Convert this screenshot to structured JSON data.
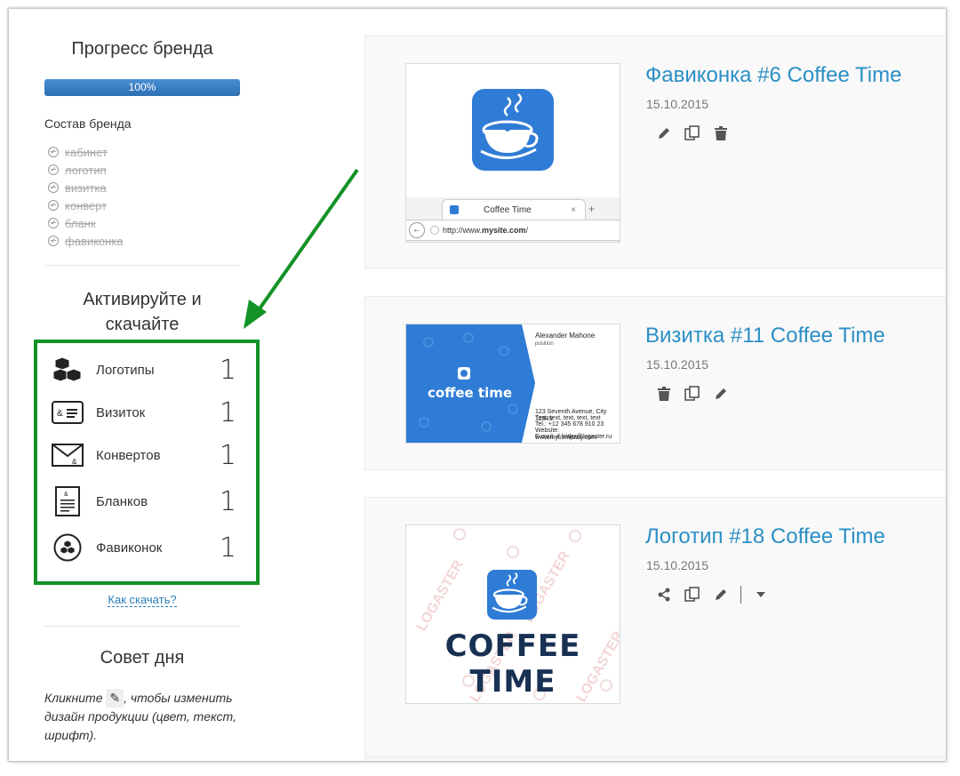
{
  "sidebar": {
    "progress_title": "Прогресс бренда",
    "progress_value": "100%",
    "progress_fraction": 1.0,
    "composition_label": "Состав бренда",
    "composition_items": [
      "кабинет",
      "логотип",
      "визитка",
      "конверт",
      "бланк",
      "фавиконка"
    ],
    "activate_title_line1": "Активируйте и",
    "activate_title_line2": "скачайте",
    "products": [
      {
        "label": "Логотипы",
        "count": "1",
        "icon": "cubes-icon"
      },
      {
        "label": "Визиток",
        "count": "1",
        "icon": "business-card-icon"
      },
      {
        "label": "Конвертов",
        "count": "1",
        "icon": "envelope-icon"
      },
      {
        "label": "Бланков",
        "count": "1",
        "icon": "letterhead-icon"
      },
      {
        "label": "Фавиконок",
        "count": "1",
        "icon": "favicon-icon"
      }
    ],
    "how_to_download": "Как скачать?",
    "tip_title": "Совет дня",
    "tip_before": "Кликните",
    "tip_after": ", чтобы изменить дизайн продукции (цвет, текст, шрифт)."
  },
  "cards": [
    {
      "title": "Фавиконка #6 Coffee Time",
      "date": "15.10.2015",
      "actions": [
        "pencil-icon",
        "copy-icon",
        "trash-icon"
      ],
      "preview": {
        "tab_title": "Coffee Time",
        "url_prefix": "http://www.",
        "url_host": "mysite.com",
        "url_suffix": "/"
      }
    },
    {
      "title": "Визитка #11 Coffee Time",
      "date": "15.10.2015",
      "actions": [
        "trash-icon",
        "copy-icon",
        "pencil-icon"
      ],
      "preview": {
        "brand": "coffee time",
        "name": "Alexander Mahone",
        "position": "position",
        "address": "123 Seventh Avenue, City 12345",
        "phone_text": "Text, text, text, text, text",
        "phone": "Tel.: +12 345 678 910 23",
        "website": "Website: www.mycompany.com",
        "email": "E-mail: d.leitler@logaster.ru"
      }
    },
    {
      "title": "Логотип #18 Coffee Time",
      "date": "15.10.2015",
      "actions": [
        "share-icon",
        "copy-icon",
        "pencil-icon",
        "caret-down-icon"
      ],
      "preview": {
        "brand": "COFFEE TIME",
        "watermark": "LOGASTER"
      }
    }
  ],
  "colors": {
    "accent": "#2b8fc6",
    "progress": "#3a7fc4",
    "highlight_box": "#139226",
    "logo_blue": "#2f7cd6"
  }
}
